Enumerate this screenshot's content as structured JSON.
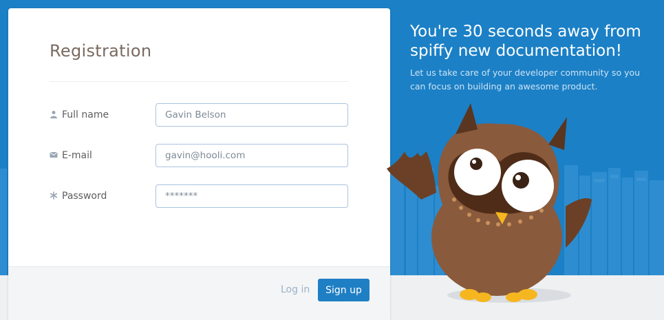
{
  "registration": {
    "title": "Registration",
    "fields": [
      {
        "label": "Full name",
        "icon": "user-icon",
        "value": "Gavin Belson"
      },
      {
        "label": "E-mail",
        "icon": "envelope-icon",
        "value": "gavin@hooli.com"
      },
      {
        "label": "Password",
        "icon": "asterisk-icon",
        "value": "*******"
      }
    ],
    "login_label": "Log in",
    "signup_label": "Sign up"
  },
  "promo": {
    "title": "You're 30 seconds away from spiffy new documentation!",
    "text": "Let us take care of your developer community so you can focus on building an awesome product."
  },
  "colors": {
    "background": "#1b80c6",
    "button": "#1f7fc4",
    "owl_body": "#8a5a3c"
  }
}
